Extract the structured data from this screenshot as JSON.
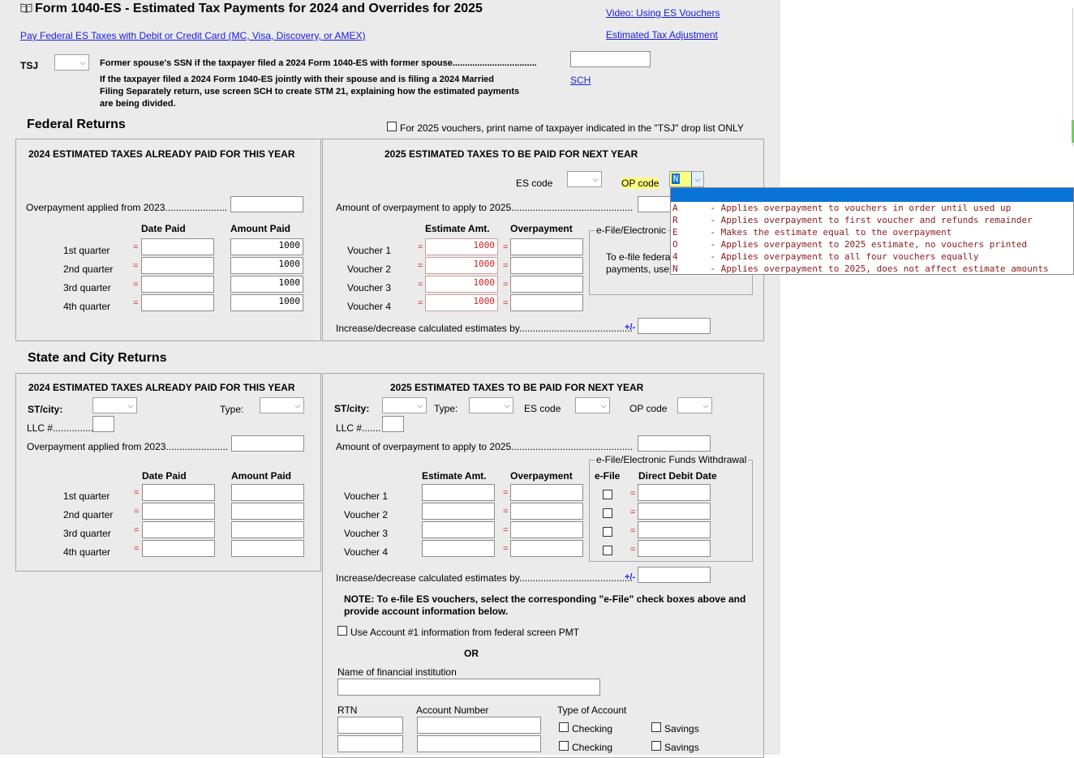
{
  "header": {
    "book_icon": "book-icon",
    "title": "Form 1040-ES - Estimated Tax Payments for 2024 and Overrides for 2025",
    "link_pay": "Pay Federal ES Taxes with Debit or Credit Card (MC, Visa, Discovery, or AMEX)",
    "link_video": "Video: Using ES Vouchers",
    "link_adjust": "Estimated Tax Adjustment",
    "tsj_label": "TSJ",
    "former_spouse_label": "Former spouse's SSN if the taxpayer filed a 2024 Form 1040-ES with former spouse..................................",
    "note_line1": "If the taxpayer filed a 2024 Form 1040-ES jointly with their spouse and is filing a 2024 Married",
    "note_line2": "Filing Separately return, use screen SCH to create STM 21, explaining how the estimated payments",
    "note_line3": "are being divided.",
    "sch_link": "SCH"
  },
  "federal": {
    "heading": "Federal Returns",
    "print_name_label": "For 2025 vouchers, print name of taxpayer indicated in the \"TSJ\" drop list ONLY",
    "paid": {
      "title": "2024 ESTIMATED TAXES ALREADY PAID FOR THIS YEAR",
      "overpayment_label": "Overpayment applied from 2023.......................",
      "col_date": "Date Paid",
      "col_amount": "Amount Paid",
      "quarters": [
        {
          "label": "1st quarter",
          "amount": "1000"
        },
        {
          "label": "2nd quarter",
          "amount": "1000"
        },
        {
          "label": "3rd quarter",
          "amount": "1000"
        },
        {
          "label": "4th quarter",
          "amount": "1000"
        }
      ]
    },
    "next": {
      "title": "2025 ESTIMATED TAXES TO BE PAID FOR NEXT YEAR",
      "es_code_label": "ES code",
      "op_code_label": "OP code",
      "op_code_value": "N",
      "overpay_apply_label": "Amount of overpayment to apply to 2025.............................................",
      "col_estimate": "Estimate Amt.",
      "col_overpayment": "Overpayment",
      "vouchers": [
        {
          "label": "Voucher 1",
          "estimate": "1000"
        },
        {
          "label": "Voucher 2",
          "estimate": "1000"
        },
        {
          "label": "Voucher 3",
          "estimate": "1000"
        },
        {
          "label": "Voucher 4",
          "estimate": "1000"
        }
      ],
      "efile_group_label": "e-File/Electronic",
      "efile_note_line1": "To e-file federa",
      "efile_note_line2": "payments, use",
      "increase_label": "Increase/decrease calculated estimates by..........................................",
      "plus_minus": "+/-"
    }
  },
  "op_dropdown": {
    "options": [
      {
        "code": "A",
        "desc": "- Applies overpayment to vouchers in order until used up"
      },
      {
        "code": "R",
        "desc": "- Applies overpayment to first voucher and refunds remainder"
      },
      {
        "code": "E",
        "desc": "- Makes the estimate equal to the overpayment"
      },
      {
        "code": "O",
        "desc": "- Applies overpayment to 2025 estimate, no vouchers printed"
      },
      {
        "code": "4",
        "desc": "- Applies overpayment to all four vouchers equally"
      },
      {
        "code": "N",
        "desc": "- Applies overpayment to 2025, does not affect estimate amounts"
      }
    ]
  },
  "state": {
    "heading": "State and City Returns",
    "paid": {
      "title": "2024 ESTIMATED TAXES ALREADY PAID FOR THIS YEAR",
      "st_city_label": "ST/city:",
      "type_label": "Type:",
      "llc_label": "LLC #...............",
      "overpayment_label": "Overpayment applied from 2023.......................",
      "col_date": "Date Paid",
      "col_amount": "Amount Paid",
      "quarters": [
        "1st quarter",
        "2nd quarter",
        "3rd quarter",
        "4th quarter"
      ]
    },
    "next": {
      "title": "2025 ESTIMATED TAXES TO BE PAID FOR NEXT YEAR",
      "st_city_label": "ST/city:",
      "type_label": "Type:",
      "es_code_label": "ES code",
      "op_code_label": "OP code",
      "llc_label": "LLC #.......",
      "overpay_apply_label": "Amount of overpayment to apply to 2025.............................................",
      "col_estimate": "Estimate Amt.",
      "col_overpayment": "Overpayment",
      "efile_group_label": "e-File/Electronic Funds Withdrawal",
      "col_efile": "e-File",
      "col_debit_date": "Direct Debit Date",
      "vouchers": [
        "Voucher 1",
        "Voucher 2",
        "Voucher 3",
        "Voucher 4"
      ],
      "increase_label": "Increase/decrease calculated estimates by..........................................",
      "plus_minus": "+/-",
      "note_line1": "NOTE: To e-file ES vouchers, select the corresponding \"e-File\" check boxes above and",
      "note_line2": "provide account information below.",
      "use_account_label": "Use Account #1 information from federal screen PMT",
      "or_label": "OR",
      "bank_name_label": "Name of financial institution",
      "rtn_label": "RTN",
      "account_number_label": "Account Number",
      "account_type_label": "Type of Account",
      "checking_label": "Checking",
      "savings_label": "Savings"
    }
  }
}
